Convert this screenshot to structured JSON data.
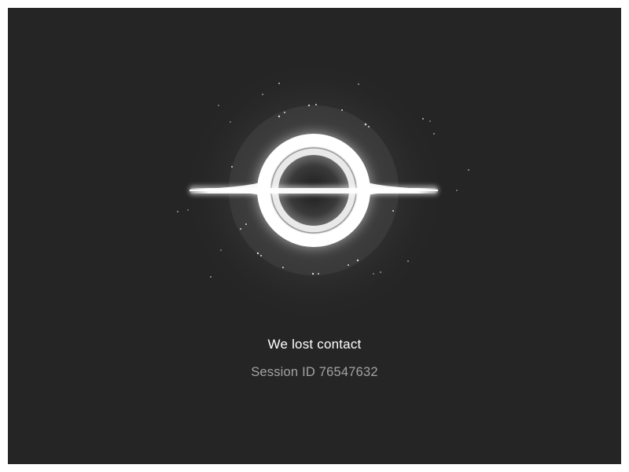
{
  "screen": {
    "background_color": "#252525",
    "frame_color": "#ffffff",
    "illustration": "black-hole-icon"
  },
  "message": {
    "title": "We lost contact",
    "session_label": "Session ID 76547632"
  },
  "colors": {
    "title_text": "#ffffff",
    "session_text": "#a3a3a3",
    "glow": "#ffffff"
  }
}
